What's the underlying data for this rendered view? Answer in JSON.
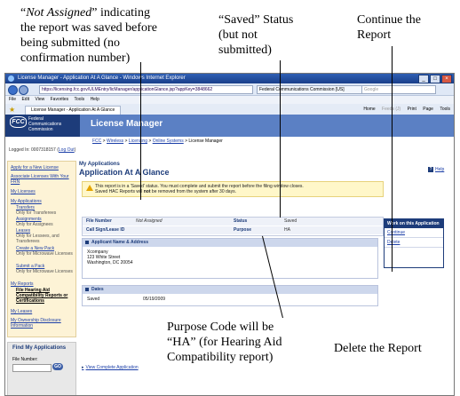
{
  "callouts": {
    "not_assigned": "“Not Assigned” indicating the report was saved before being submitted (no confirmation number)",
    "not_assigned_italic": "Not Assigned",
    "not_assigned_rest_1": "” indicating",
    "not_assigned_line_2": "the report was saved before",
    "not_assigned_line_3": "being submitted (no",
    "not_assigned_line_4": "confirmation number)",
    "saved_status_1": "“Saved” Status",
    "saved_status_2": "(but not",
    "saved_status_3": "submitted)",
    "continue_1": "Continue the",
    "continue_2": "Report",
    "purpose_1": "Purpose Code will be",
    "purpose_2": "“HA” (for Hearing Aid",
    "purpose_3": "Compatibility report)",
    "delete": "Delete the Report"
  },
  "browser": {
    "title": "License Manager - Application At A Glance - Windows Internet Explorer",
    "url": "https://licensing.fcc.gov/ULMEntry/licManager/applicationGlance.jsp?appKey=3848662",
    "site_id": "Federal Communications Commission [US]",
    "search_placeholder": "Google",
    "menu": [
      "File",
      "Edit",
      "View",
      "Favorites",
      "Tools",
      "Help"
    ],
    "tab_label": "License Manager - Application At A Glance",
    "toolbar": [
      "Home",
      "Feeds (J)",
      "Print",
      "Page",
      "Tools"
    ]
  },
  "header": {
    "logo": "FCC",
    "agency_1": "Federal",
    "agency_2": "Communications",
    "agency_3": "Commission",
    "app_title": "License Manager"
  },
  "breadcrumb": {
    "fcc": "FCC",
    "wireless": "Wireless",
    "licensing": "Licensing",
    "online": "Online Systems",
    "current": "License Manager",
    "sep": " > "
  },
  "logged_in": {
    "label": "Logged In: 0007318157",
    "logout": "Log Out"
  },
  "sidebar": {
    "items": [
      "Apply for a New License",
      "Associate Licenses With Your FRN",
      "My Licenses",
      "My Applications",
      "Transfers",
      "Only for Transferees",
      "Assignments",
      "Only for Assignees",
      "Leases",
      "Only for Lessees, and Transferees",
      "Create a New Pack",
      "Only for Microwave Licenses",
      "Submit a Pack",
      "Only for Microwave Licenses",
      "My Reports",
      "File Hearing Aid Compatibility Reports or Certifications",
      "My Leases",
      "My Ownership Disclosure Information"
    ]
  },
  "find_app": {
    "title": "Find My Applications",
    "label": "File Number:",
    "go": "GO"
  },
  "main": {
    "section_label": "My Applications",
    "title": "Application At A Glance",
    "help": "Help",
    "notice_1": "This report is in a 'Saved' status. You must complete and submit the report before the filing window closes.",
    "notice_2a": "Saved HAC Reports will ",
    "notice_2b": "not",
    "notice_2c": " be removed from the system after 30 days.",
    "file_number_label": "File Number",
    "file_number_value": "Not Assigned",
    "status_label": "Status",
    "status_value": "Saved",
    "callsign_label": "Call Sign/Lease ID",
    "purpose_label": "Purpose",
    "purpose_value": "HA",
    "applicant_header": "Applicant Name & Address",
    "applicant_name": "Xcompany",
    "applicant_street": "123 White Street",
    "applicant_city": "Washington, DC 20054",
    "dates_header": "Dates",
    "saved_label": "Saved",
    "saved_date": "05/19/2009",
    "view_complete": "View Complete Application"
  },
  "work_panel": {
    "title": "Work on this Application",
    "continue": "Continue",
    "delete": "Delete"
  }
}
